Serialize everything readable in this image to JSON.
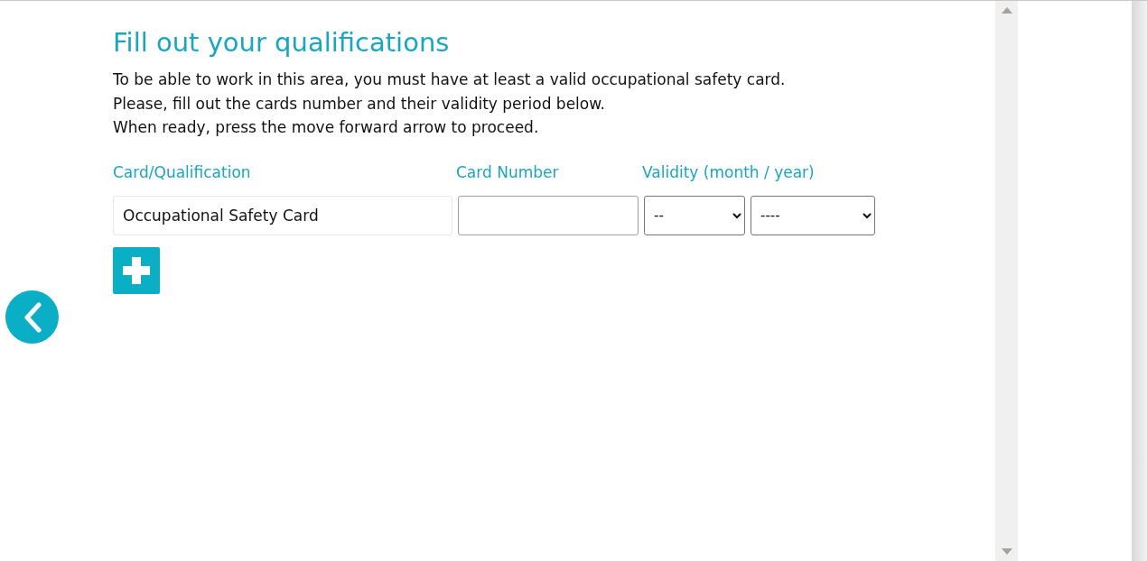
{
  "title": "Fill out your qualifications",
  "instructions": [
    "To be able to work in this area, you must have at least a valid occupational safety card.",
    "Please, fill out the cards number and their validity period below.",
    "When ready, press the move forward arrow to proceed."
  ],
  "columns": [
    "Card/Qualification",
    "Card Number",
    "Validity (month / year)"
  ],
  "rows": [
    {
      "qualification": "Occupational Safety Card",
      "month": "--",
      "year": "----"
    }
  ]
}
